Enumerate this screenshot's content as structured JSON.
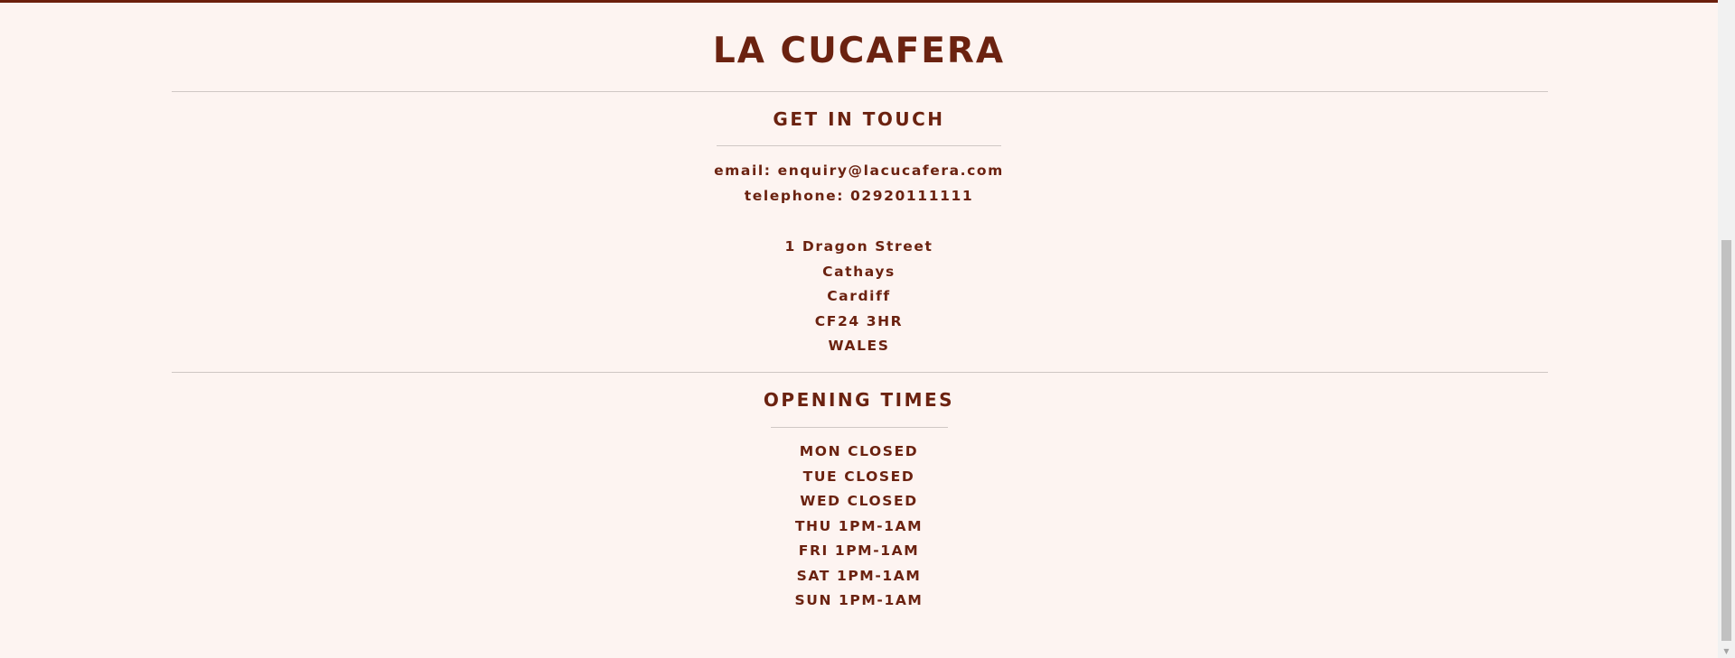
{
  "brand": {
    "name": "LA CUCAFERA"
  },
  "contact": {
    "heading": "GET IN TOUCH",
    "email": "email: enquiry@lacucafera.com",
    "telephone": "telephone: 02920111111",
    "address": [
      "1 Dragon Street",
      "Cathays",
      "Cardiff",
      "CF24 3HR",
      "WALES"
    ]
  },
  "hours": {
    "heading": "OPENING TIMES",
    "days": [
      "MON CLOSED",
      "TUE CLOSED",
      "WED CLOSED",
      "THU 1PM-1AM",
      "FRI 1PM-1AM",
      "SAT 1PM-1AM",
      "SUN 1PM-1AM"
    ]
  },
  "scrollbar": {
    "arrow_down": "▼"
  },
  "colors": {
    "text": "#6b2210",
    "background": "#fdf4f1",
    "border": "#6b1f0c"
  }
}
